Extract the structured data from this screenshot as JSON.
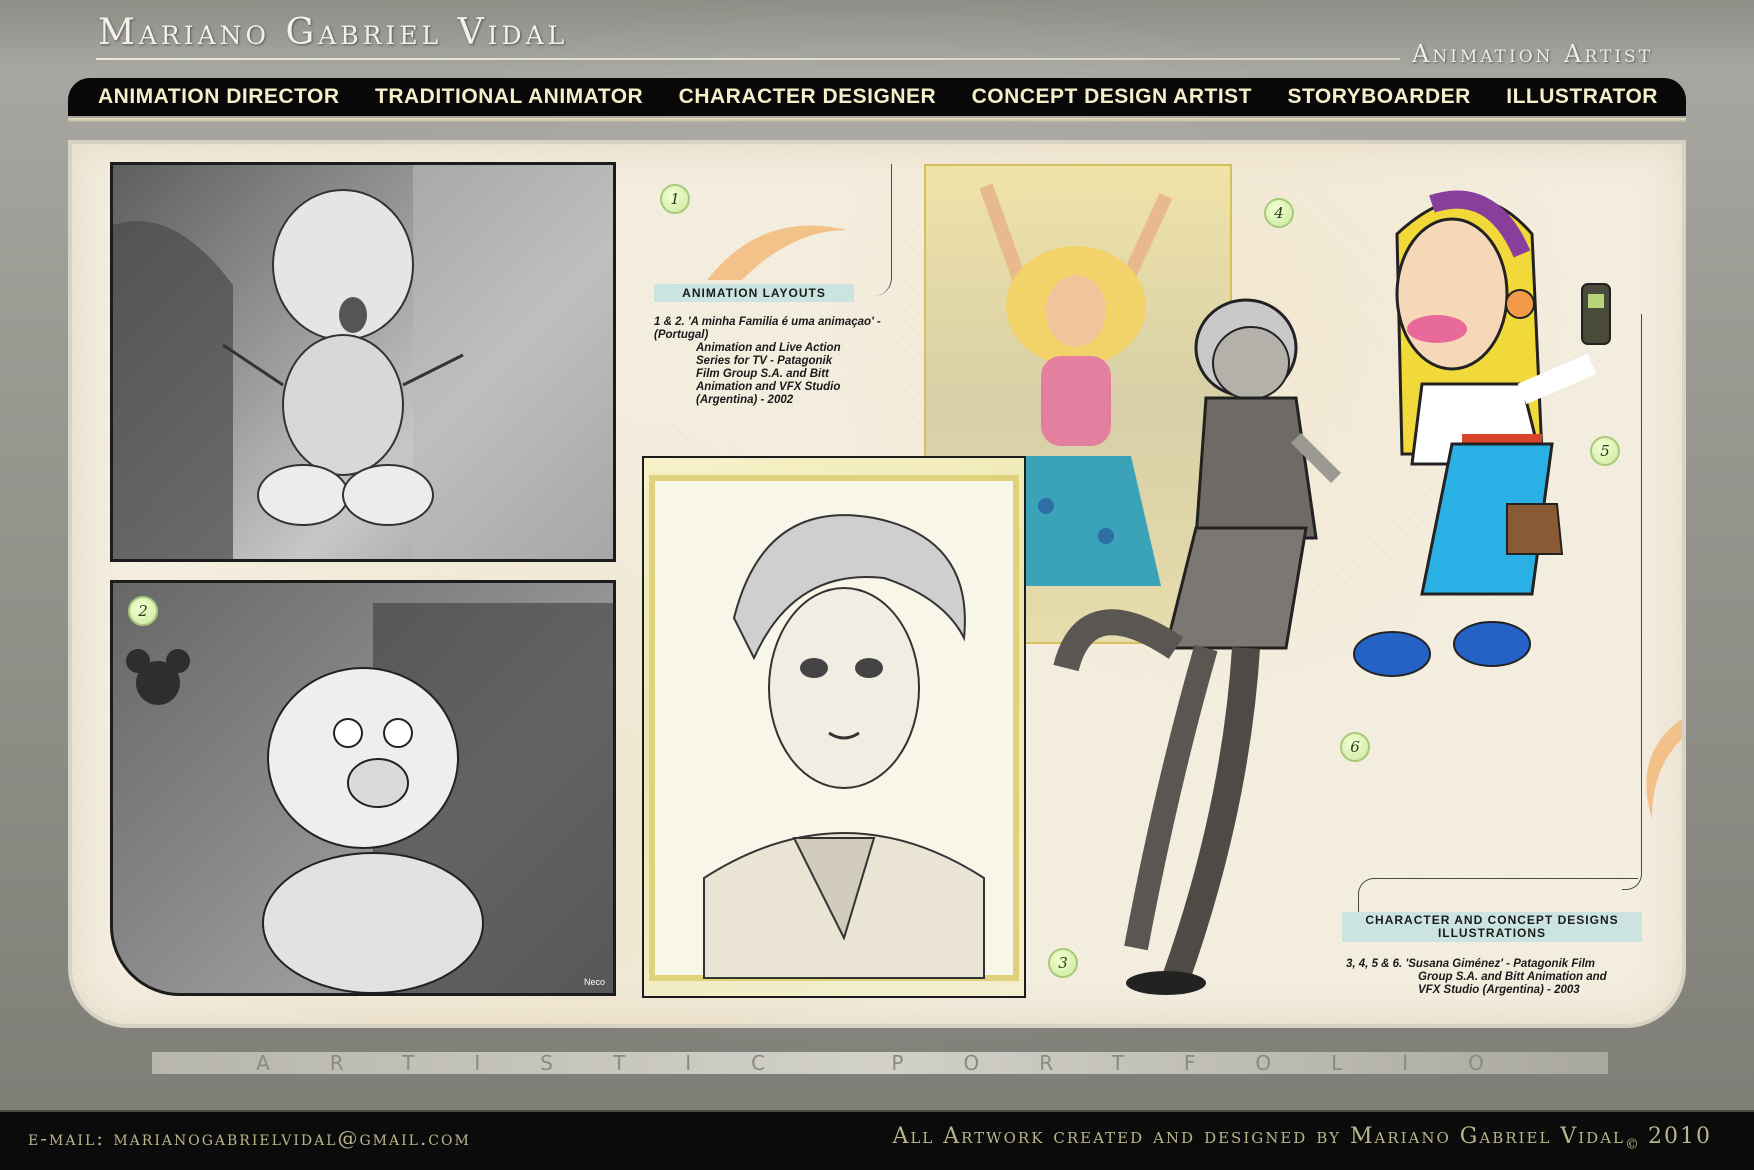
{
  "header": {
    "title": "Mariano Gabriel Vidal",
    "subtitle": "Animation Artist"
  },
  "nav": {
    "items": [
      {
        "label": "ANIMATION DIRECTOR"
      },
      {
        "label": "TRADITIONAL ANIMATOR"
      },
      {
        "label": "CHARACTER DESIGNER"
      },
      {
        "label": "CONCEPT DESIGN ARTIST"
      },
      {
        "label": "STORYBOARDER"
      },
      {
        "label": "ILLUSTRATOR"
      }
    ]
  },
  "badges": [
    "1",
    "2",
    "3",
    "4",
    "5",
    "6"
  ],
  "layouts": {
    "tag": "ANIMATION LAYOUTS",
    "caption_prefix": "1 & 2.",
    "caption_title": "'A minha Familia é uma animaçao'",
    "caption_line1_rest": " - (Portugal)",
    "caption_lines": [
      "Animation and Live Action",
      "Series for TV - Patagonik",
      "Film Group S.A. and Bitt",
      "Animation and VFX Studio",
      "(Argentina) - 2002"
    ],
    "frame_credit": "Neco"
  },
  "characters": {
    "tag_line1": "CHARACTER AND CONCEPT DESIGNS",
    "tag_line2": "ILLUSTRATIONS",
    "caption_prefix": "3, 4, 5 & 6.",
    "caption_title": "'Susana Giménez'",
    "caption_line1_rest": " - Patagonik Film",
    "caption_lines": [
      "Group S.A. and Bitt Animation and",
      "VFX Studio (Argentina) - 2003"
    ]
  },
  "portfolio_banner": "ARTISTIC PORTFOLIO",
  "footer": {
    "email": "e-mail: marianogabrielvidal@gmail.com",
    "credit": "All Artwork created and designed by Mariano Gabriel Vidal",
    "copyright_symbol": "©",
    "year": "2010"
  },
  "colors": {
    "nav_bg": "#080808",
    "nav_text": "#f4efc9",
    "panel_bg": "#f4eee0",
    "tag_bg": "#cbe4e0",
    "footer_text": "#b9b58a"
  }
}
